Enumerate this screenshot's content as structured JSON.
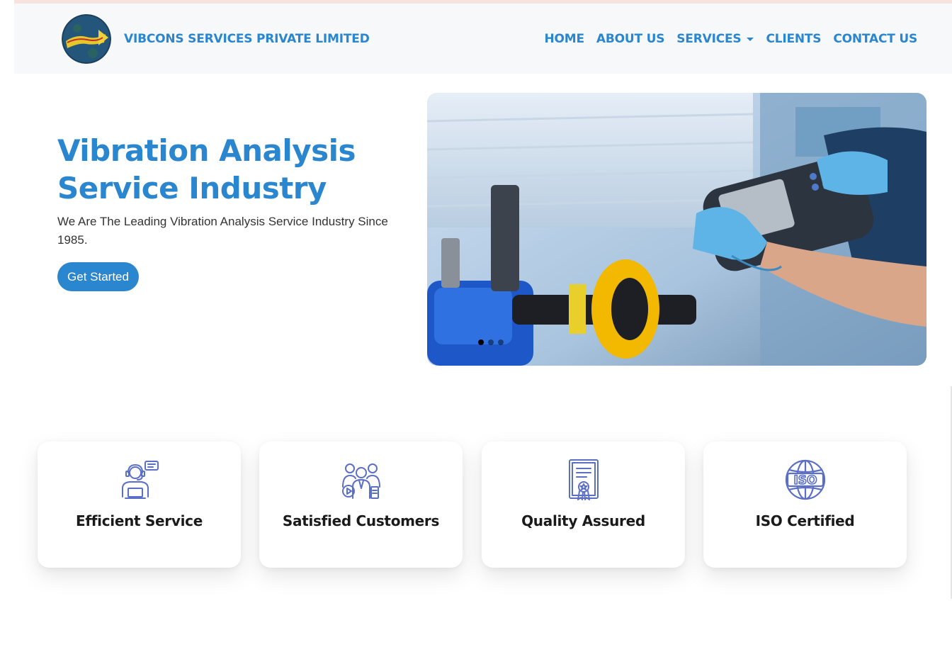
{
  "brand": {
    "name": "VIBCONS SERVICES PRIVATE LIMITED"
  },
  "nav": {
    "items": [
      {
        "label": "HOME"
      },
      {
        "label": "ABOUT US"
      },
      {
        "label": "SERVICES"
      },
      {
        "label": "CLIENTS"
      },
      {
        "label": "CONTACT US"
      }
    ]
  },
  "hero": {
    "title": "Vibration Analysis Service Industry",
    "subtitle": "We Are The Leading Vibration Analysis Service Industry Since 1985.",
    "cta_label": "Get Started"
  },
  "carousel": {
    "active_index": 0,
    "slide_count": 3
  },
  "features": [
    {
      "label": "Efficient Service",
      "icon": "support-agent-icon"
    },
    {
      "label": "Satisfied Customers",
      "icon": "customer-group-icon"
    },
    {
      "label": "Quality Assured",
      "icon": "certificate-icon"
    },
    {
      "label": "ISO Certified",
      "icon": "iso-globe-icon"
    }
  ],
  "colors": {
    "accent": "#2a86cf",
    "icon": "#5b6fc7"
  }
}
